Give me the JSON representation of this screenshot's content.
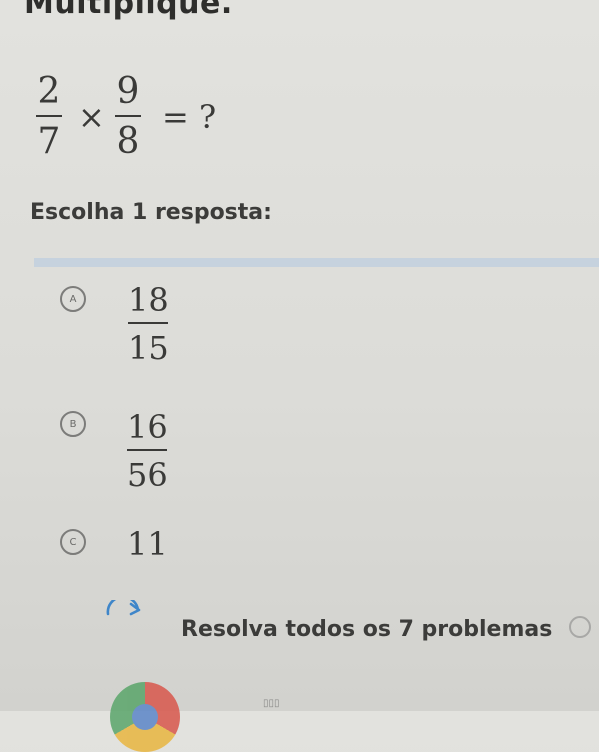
{
  "header": {
    "title": "Multiplique."
  },
  "question": {
    "fraction_a": {
      "numerator": "2",
      "denominator": "7"
    },
    "operator": "×",
    "fraction_b": {
      "numerator": "9",
      "denominator": "8"
    },
    "equals": "= ?"
  },
  "prompt": "Escolha 1 resposta:",
  "choices": [
    {
      "letter": "A",
      "numerator": "18",
      "denominator": "15"
    },
    {
      "letter": "B",
      "numerator": "16",
      "denominator": "56"
    },
    {
      "letter": "C",
      "value": "11"
    }
  ],
  "footer": {
    "action_label": "Resolva todos os 7 problemas",
    "reload_icon": "reload-icon"
  },
  "colors": {
    "background": "#dcdcd8",
    "text": "#3a3a38",
    "divider": "#c6d2de",
    "reload_icon": "#3f86c9"
  }
}
